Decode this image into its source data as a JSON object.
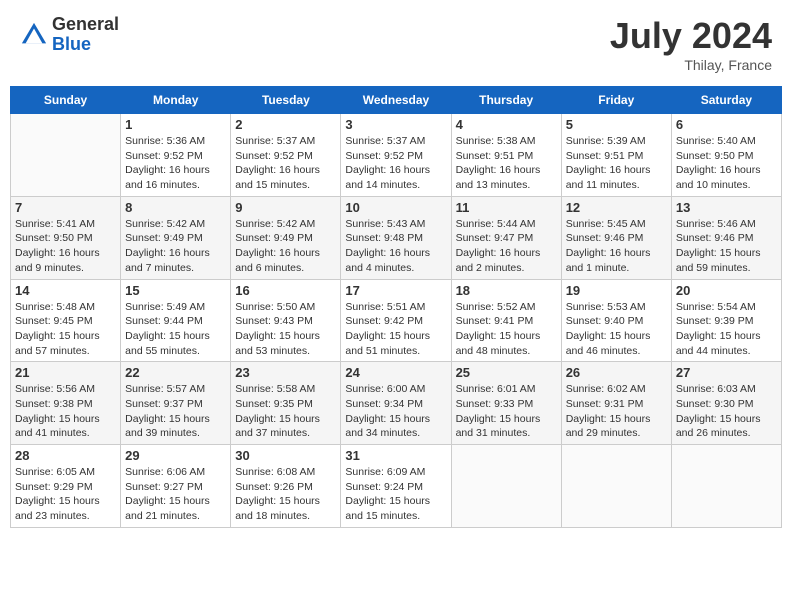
{
  "header": {
    "logo_general": "General",
    "logo_blue": "Blue",
    "month_title": "July 2024",
    "location": "Thilay, France"
  },
  "days_of_week": [
    "Sunday",
    "Monday",
    "Tuesday",
    "Wednesday",
    "Thursday",
    "Friday",
    "Saturday"
  ],
  "weeks": [
    [
      {
        "day": "",
        "info": ""
      },
      {
        "day": "1",
        "info": "Sunrise: 5:36 AM\nSunset: 9:52 PM\nDaylight: 16 hours\nand 16 minutes."
      },
      {
        "day": "2",
        "info": "Sunrise: 5:37 AM\nSunset: 9:52 PM\nDaylight: 16 hours\nand 15 minutes."
      },
      {
        "day": "3",
        "info": "Sunrise: 5:37 AM\nSunset: 9:52 PM\nDaylight: 16 hours\nand 14 minutes."
      },
      {
        "day": "4",
        "info": "Sunrise: 5:38 AM\nSunset: 9:51 PM\nDaylight: 16 hours\nand 13 minutes."
      },
      {
        "day": "5",
        "info": "Sunrise: 5:39 AM\nSunset: 9:51 PM\nDaylight: 16 hours\nand 11 minutes."
      },
      {
        "day": "6",
        "info": "Sunrise: 5:40 AM\nSunset: 9:50 PM\nDaylight: 16 hours\nand 10 minutes."
      }
    ],
    [
      {
        "day": "7",
        "info": "Sunrise: 5:41 AM\nSunset: 9:50 PM\nDaylight: 16 hours\nand 9 minutes."
      },
      {
        "day": "8",
        "info": "Sunrise: 5:42 AM\nSunset: 9:49 PM\nDaylight: 16 hours\nand 7 minutes."
      },
      {
        "day": "9",
        "info": "Sunrise: 5:42 AM\nSunset: 9:49 PM\nDaylight: 16 hours\nand 6 minutes."
      },
      {
        "day": "10",
        "info": "Sunrise: 5:43 AM\nSunset: 9:48 PM\nDaylight: 16 hours\nand 4 minutes."
      },
      {
        "day": "11",
        "info": "Sunrise: 5:44 AM\nSunset: 9:47 PM\nDaylight: 16 hours\nand 2 minutes."
      },
      {
        "day": "12",
        "info": "Sunrise: 5:45 AM\nSunset: 9:46 PM\nDaylight: 16 hours\nand 1 minute."
      },
      {
        "day": "13",
        "info": "Sunrise: 5:46 AM\nSunset: 9:46 PM\nDaylight: 15 hours\nand 59 minutes."
      }
    ],
    [
      {
        "day": "14",
        "info": "Sunrise: 5:48 AM\nSunset: 9:45 PM\nDaylight: 15 hours\nand 57 minutes."
      },
      {
        "day": "15",
        "info": "Sunrise: 5:49 AM\nSunset: 9:44 PM\nDaylight: 15 hours\nand 55 minutes."
      },
      {
        "day": "16",
        "info": "Sunrise: 5:50 AM\nSunset: 9:43 PM\nDaylight: 15 hours\nand 53 minutes."
      },
      {
        "day": "17",
        "info": "Sunrise: 5:51 AM\nSunset: 9:42 PM\nDaylight: 15 hours\nand 51 minutes."
      },
      {
        "day": "18",
        "info": "Sunrise: 5:52 AM\nSunset: 9:41 PM\nDaylight: 15 hours\nand 48 minutes."
      },
      {
        "day": "19",
        "info": "Sunrise: 5:53 AM\nSunset: 9:40 PM\nDaylight: 15 hours\nand 46 minutes."
      },
      {
        "day": "20",
        "info": "Sunrise: 5:54 AM\nSunset: 9:39 PM\nDaylight: 15 hours\nand 44 minutes."
      }
    ],
    [
      {
        "day": "21",
        "info": "Sunrise: 5:56 AM\nSunset: 9:38 PM\nDaylight: 15 hours\nand 41 minutes."
      },
      {
        "day": "22",
        "info": "Sunrise: 5:57 AM\nSunset: 9:37 PM\nDaylight: 15 hours\nand 39 minutes."
      },
      {
        "day": "23",
        "info": "Sunrise: 5:58 AM\nSunset: 9:35 PM\nDaylight: 15 hours\nand 37 minutes."
      },
      {
        "day": "24",
        "info": "Sunrise: 6:00 AM\nSunset: 9:34 PM\nDaylight: 15 hours\nand 34 minutes."
      },
      {
        "day": "25",
        "info": "Sunrise: 6:01 AM\nSunset: 9:33 PM\nDaylight: 15 hours\nand 31 minutes."
      },
      {
        "day": "26",
        "info": "Sunrise: 6:02 AM\nSunset: 9:31 PM\nDaylight: 15 hours\nand 29 minutes."
      },
      {
        "day": "27",
        "info": "Sunrise: 6:03 AM\nSunset: 9:30 PM\nDaylight: 15 hours\nand 26 minutes."
      }
    ],
    [
      {
        "day": "28",
        "info": "Sunrise: 6:05 AM\nSunset: 9:29 PM\nDaylight: 15 hours\nand 23 minutes."
      },
      {
        "day": "29",
        "info": "Sunrise: 6:06 AM\nSunset: 9:27 PM\nDaylight: 15 hours\nand 21 minutes."
      },
      {
        "day": "30",
        "info": "Sunrise: 6:08 AM\nSunset: 9:26 PM\nDaylight: 15 hours\nand 18 minutes."
      },
      {
        "day": "31",
        "info": "Sunrise: 6:09 AM\nSunset: 9:24 PM\nDaylight: 15 hours\nand 15 minutes."
      },
      {
        "day": "",
        "info": ""
      },
      {
        "day": "",
        "info": ""
      },
      {
        "day": "",
        "info": ""
      }
    ]
  ]
}
